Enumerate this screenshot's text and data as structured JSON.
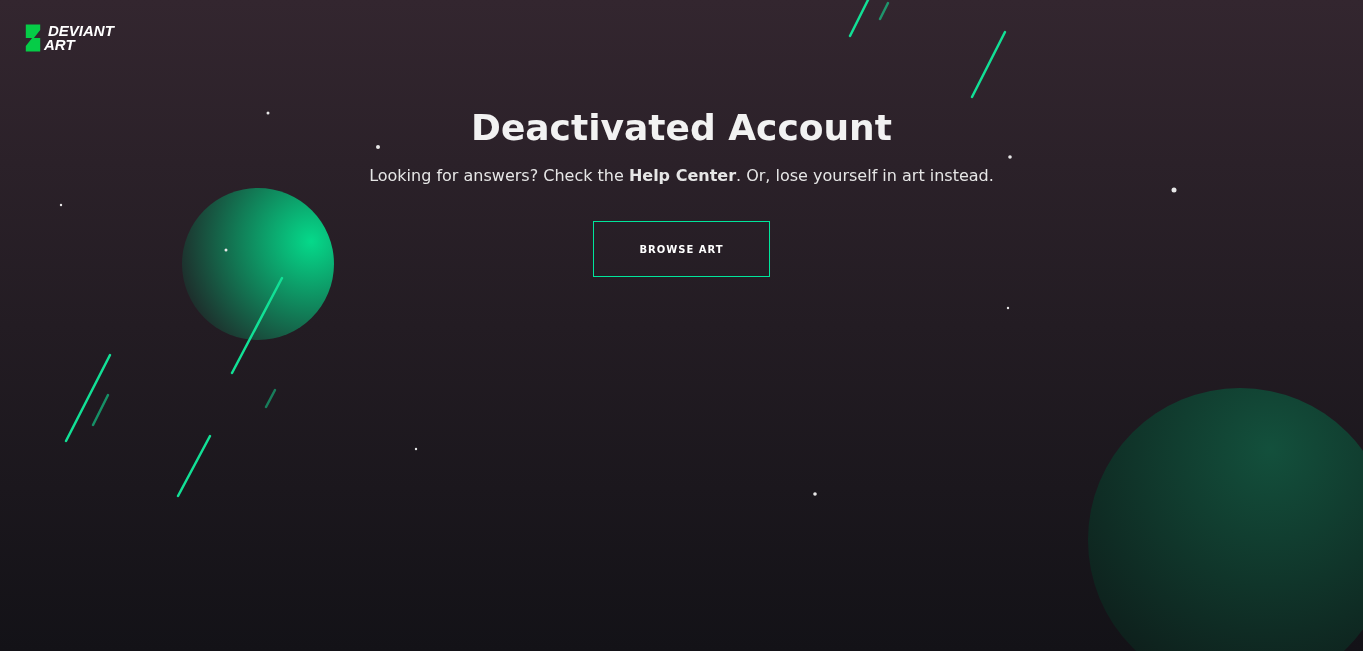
{
  "logo": {
    "lines": [
      "DEVIANT",
      "ART"
    ]
  },
  "heading": "Deactivated Account",
  "message": "Looking for answers? Check the **Help Center**. Or, lose yourself in art instead.",
  "button": "BROWSE ART"
}
